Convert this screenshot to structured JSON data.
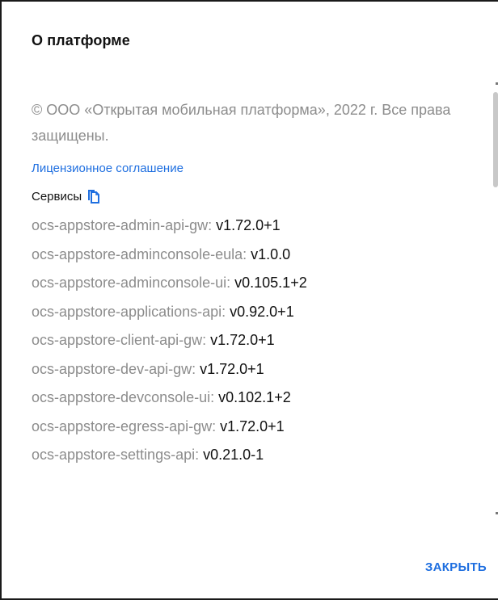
{
  "dialog": {
    "title": "О платформе",
    "copyright": "© ООО «Открытая мобильная платформа», 2022 г. Все права защищены.",
    "license_link": "Лицензионное соглашение",
    "services_label": "Сервисы",
    "copy_icon": "copy-icon",
    "services": [
      {
        "name": "ocs-appstore-admin-api-gw",
        "version": "v1.72.0+1"
      },
      {
        "name": "ocs-appstore-adminconsole-eula",
        "version": "v1.0.0"
      },
      {
        "name": "ocs-appstore-adminconsole-ui",
        "version": "v0.105.1+2"
      },
      {
        "name": "ocs-appstore-applications-api",
        "version": "v0.92.0+1"
      },
      {
        "name": "ocs-appstore-client-api-gw",
        "version": "v1.72.0+1"
      },
      {
        "name": "ocs-appstore-dev-api-gw",
        "version": "v1.72.0+1"
      },
      {
        "name": "ocs-appstore-devconsole-ui",
        "version": "v0.102.1+2"
      },
      {
        "name": "ocs-appstore-egress-api-gw",
        "version": "v1.72.0+1"
      },
      {
        "name": "ocs-appstore-settings-api",
        "version": "v0.21.0-1"
      }
    ],
    "close_label": "ЗАКРЫТЬ"
  },
  "colors": {
    "accent": "#1f6fe0",
    "muted_text": "#8c8c8c",
    "primary_text": "#111111"
  }
}
